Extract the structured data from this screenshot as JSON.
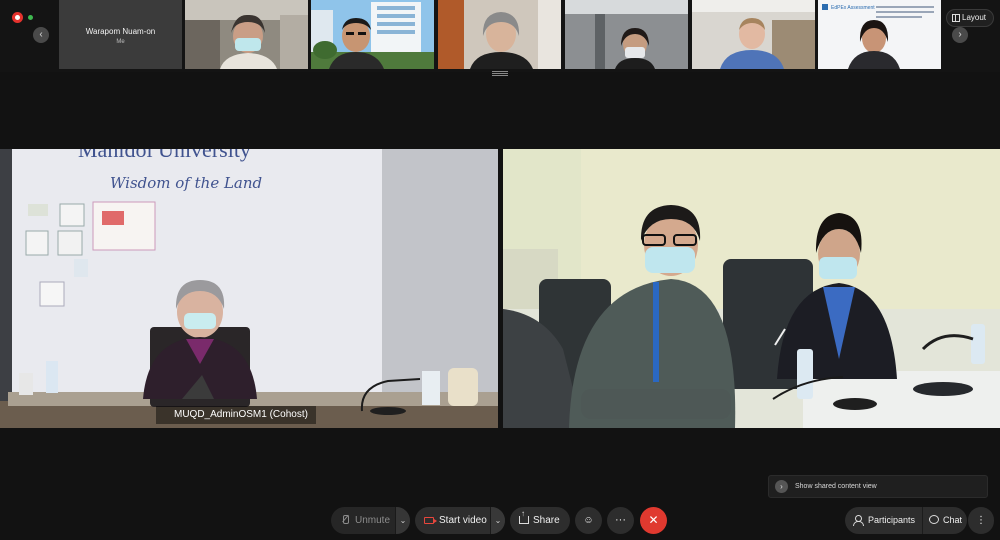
{
  "filmstrip": {
    "self_name": "Warapom Nuam-on",
    "self_label": "Me",
    "layout_label": "Layout",
    "prev_icon": "‹",
    "next_icon": "›"
  },
  "main": {
    "left_participant_name": "MUQD_AdminOSM1 (Cohost)",
    "left_wall_text_top": "Mahidol University",
    "left_wall_text_bottom": "Wisdom of the Land"
  },
  "thumbnails": {
    "slide_title": "EdPEx Assessment"
  },
  "shared_content": {
    "label": "Show shared content view"
  },
  "controls": {
    "unmute_label": "Unmute",
    "start_video_label": "Start video",
    "share_label": "Share",
    "reactions_icon": "☺",
    "more_icon": "···",
    "end_icon": "✕",
    "participants_label": "Participants",
    "chat_label": "Chat",
    "panel_more_icon": "⋮",
    "caret": "⌄"
  },
  "colors": {
    "background": "#121212",
    "end_call": "#e0392f",
    "video_off": "#e8463c",
    "record": "#e5322d"
  }
}
